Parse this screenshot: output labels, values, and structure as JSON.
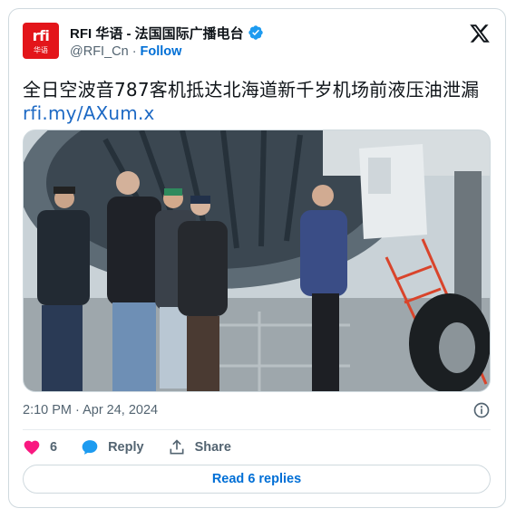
{
  "author": {
    "avatar_text": "rfi",
    "avatar_subtext": "华语",
    "display_name": "RFI 华语 - 法国国际广播电台",
    "handle": "@RFI_Cn",
    "separator": "·",
    "follow_label": "Follow",
    "verified": true
  },
  "tweet": {
    "text": "全日空波音787客机抵达北海道新千岁机场前液压油泄漏",
    "link": "rfi.my/AXum.x",
    "timestamp": "2:10 PM · Apr 24, 2024"
  },
  "engagement": {
    "likes_count": "6",
    "reply_label": "Reply",
    "share_label": "Share",
    "read_replies_label": "Read 6 replies"
  },
  "colors": {
    "accent": "#1d9bf0",
    "like": "#f91880",
    "rfi_red": "#e3151a"
  }
}
